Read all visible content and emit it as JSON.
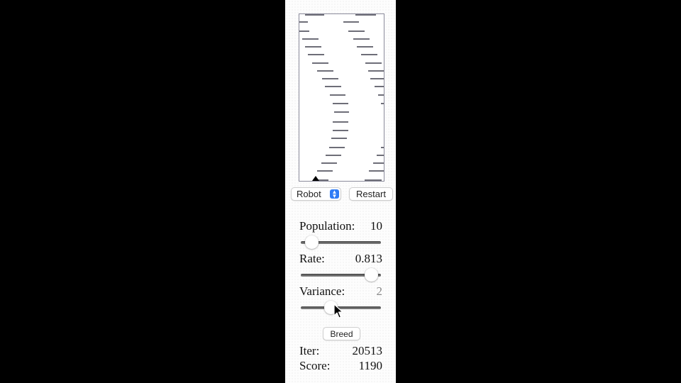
{
  "game": {
    "area_label": "game-canvas"
  },
  "controls": {
    "mode_value": "Robot",
    "restart_label": "Restart",
    "breed_label": "Breed"
  },
  "params": {
    "population": {
      "label": "Population:",
      "value": "10",
      "level": 0.14
    },
    "rate": {
      "label": "Rate:",
      "value": "0.813",
      "level": 0.88
    },
    "variance": {
      "label": "Variance:",
      "value": "2",
      "level": 0.38
    }
  },
  "stats": {
    "iter_label": "Iter:",
    "iter_value": "20513",
    "score_label": "Score:",
    "score_value": "1190"
  },
  "colors": {
    "background": "#000000",
    "panel": "#fdfdfd",
    "obstacle": "#6e6e78",
    "select_accent": "#2f7cf6"
  }
}
